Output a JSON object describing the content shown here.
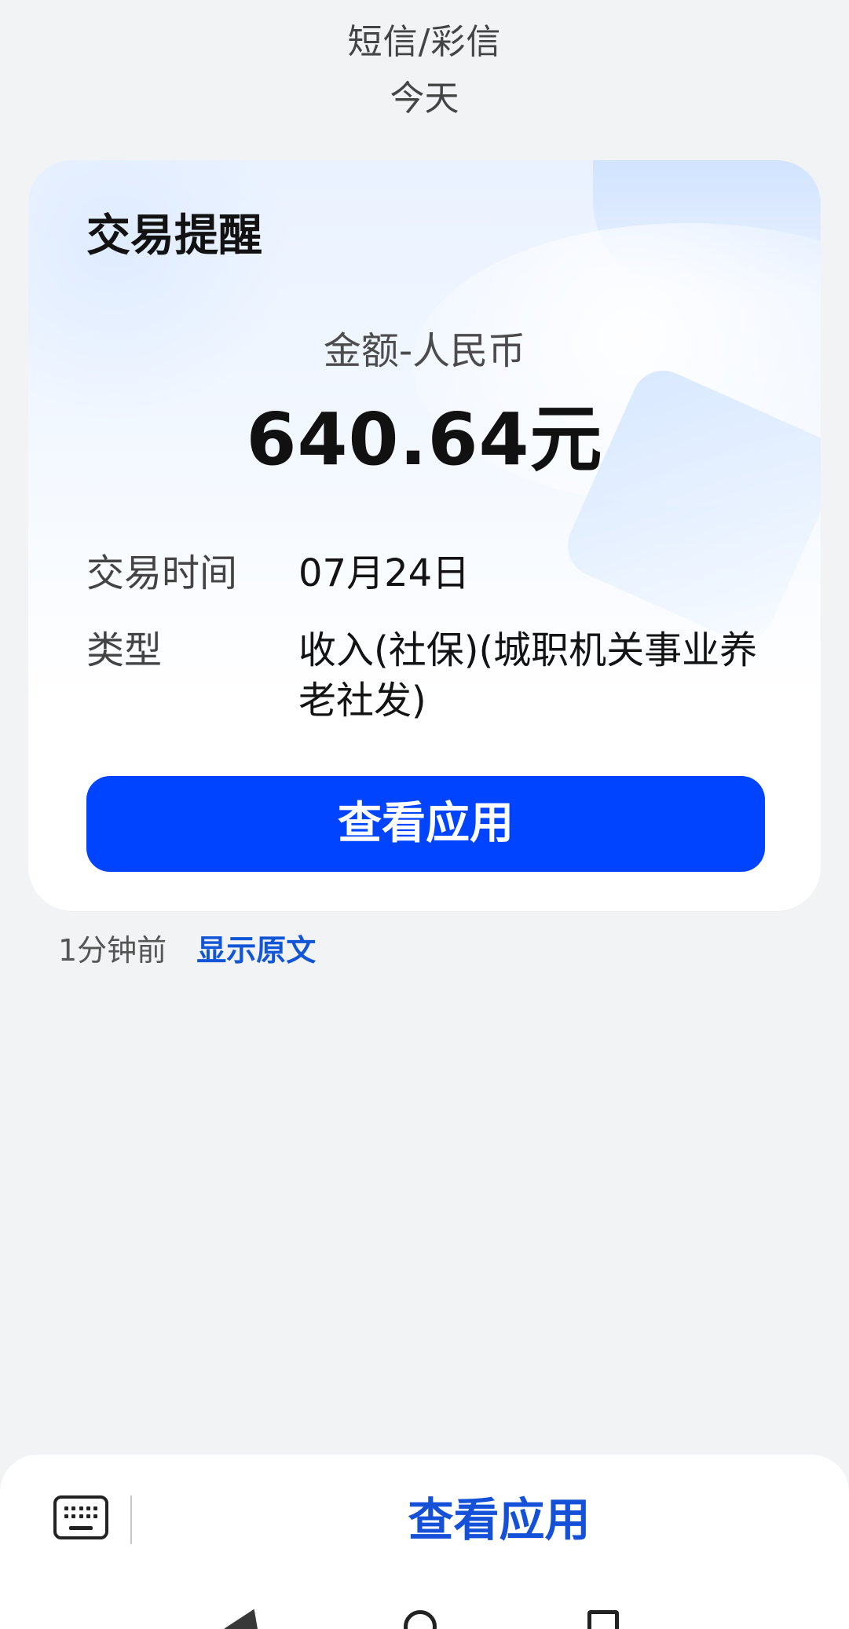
{
  "header": {
    "title": "短信/彩信",
    "date": "今天"
  },
  "card": {
    "title": "交易提醒",
    "amount_label": "金额-人民币",
    "amount_value": "640.64元",
    "details": [
      {
        "label": "交易时间",
        "value": "07月24日"
      },
      {
        "label": "类型",
        "value": "收入(社保)(城职机关事业养老社发)"
      }
    ],
    "button_label": "查看应用"
  },
  "meta": {
    "time": "1分钟前",
    "show_original": "显示原文"
  },
  "bottom_bar": {
    "keyboard_icon": "keyboard-icon",
    "action_label": "查看应用"
  },
  "navigation": {
    "back_icon": "back-icon",
    "home_icon": "home-icon",
    "recent_icon": "recent-apps-icon"
  },
  "colors": {
    "primary_button": "#0044ff",
    "link": "#1056d6",
    "background": "#f2f3f5"
  }
}
